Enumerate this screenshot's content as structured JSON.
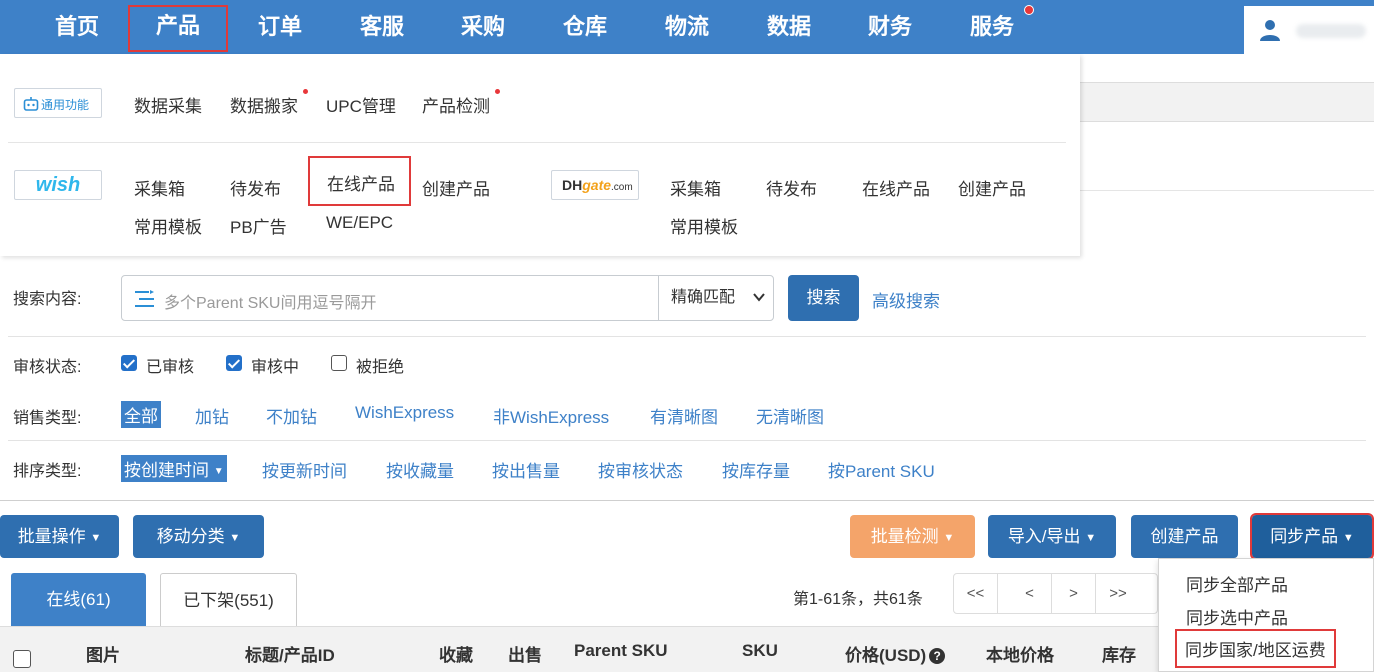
{
  "nav": {
    "items": [
      "首页",
      "产品",
      "订单",
      "客服",
      "采购",
      "仓库",
      "物流",
      "数据",
      "财务",
      "服务"
    ],
    "active_index": 1,
    "notification_on_index": 9
  },
  "dropdown": {
    "general": {
      "badge": "通用功能",
      "links": [
        "数据采集",
        "数据搬家",
        "UPC管理",
        "产品检测"
      ]
    },
    "wish": {
      "logo": "wish",
      "row1": [
        "采集箱",
        "待发布",
        "在线产品",
        "创建产品"
      ],
      "row2": [
        "常用模板",
        "PB广告",
        "WE/EPC"
      ],
      "highlighted": "在线产品"
    },
    "dhgate": {
      "logo_dh": "DH",
      "logo_gate": "gate",
      "logo_com": ".com",
      "row1": [
        "采集箱",
        "待发布",
        "在线产品",
        "创建产品"
      ],
      "row2": [
        "常用模板"
      ]
    }
  },
  "filters": {
    "search_label": "搜索内容:",
    "search_placeholder": "多个Parent SKU间用逗号隔开",
    "match_mode": "精确匹配",
    "search_button": "搜索",
    "advanced_link": "高级搜索",
    "review_label": "审核状态:",
    "review_options": [
      {
        "label": "已审核",
        "checked": true
      },
      {
        "label": "审核中",
        "checked": true
      },
      {
        "label": "被拒绝",
        "checked": false
      }
    ],
    "sales_label": "销售类型:",
    "sales_options": [
      "全部",
      "加钻",
      "不加钻",
      "WishExpress",
      "非WishExpress",
      "有清晰图",
      "无清晰图"
    ],
    "sort_label": "排序类型:",
    "sort_selected": "按创建时间",
    "sort_options": [
      "按更新时间",
      "按收藏量",
      "按出售量",
      "按审核状态",
      "按库存量",
      "按Parent SKU"
    ]
  },
  "actions": {
    "batch_ops": "批量操作",
    "move_category": "移动分类",
    "batch_check": "批量检测",
    "import_export": "导入/导出",
    "create_product": "创建产品",
    "sync_products": "同步产品"
  },
  "tabs": {
    "online": "在线(61)",
    "delisted": "已下架(551)"
  },
  "pagination": {
    "summary": "第1-61条，共61条",
    "buttons": [
      "<<",
      "<",
      ">",
      ">>"
    ]
  },
  "table": {
    "headers": [
      "图片",
      "标题/产品ID",
      "收藏",
      "出售",
      "Parent SKU",
      "SKU",
      "价格(USD)",
      "本地价格",
      "库存"
    ],
    "price_help": "?"
  },
  "sync_menu": {
    "items": [
      "同步全部产品",
      "同步选中产品",
      "同步国家/地区运费"
    ],
    "highlighted_index": 2
  },
  "colors": {
    "nav_bg": "#3e81c8",
    "primary": "#2f6fb0",
    "orange": "#f4a46a",
    "highlight_red": "#e03a3a"
  }
}
